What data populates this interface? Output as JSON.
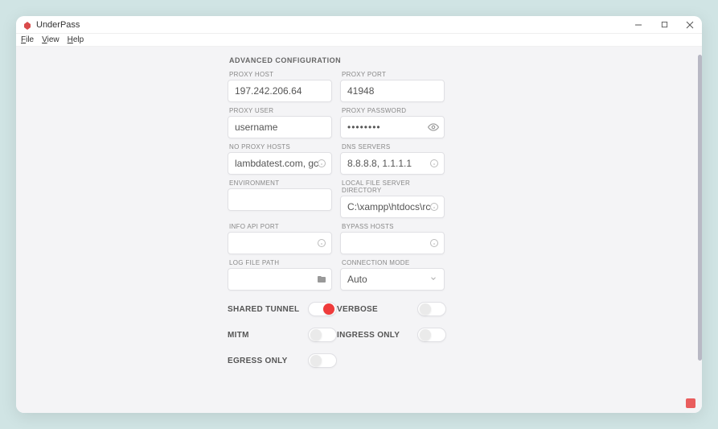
{
  "window": {
    "title": "UnderPass",
    "menu": {
      "file": "File",
      "view": "View",
      "help": "Help"
    }
  },
  "section": {
    "title": "ADVANCED CONFIGURATION"
  },
  "fields": {
    "proxy_host": {
      "label": "PROXY HOST",
      "value": "197.242.206.64"
    },
    "proxy_port": {
      "label": "PROXY PORT",
      "value": "41948"
    },
    "proxy_user": {
      "label": "PROXY USER",
      "value": "username"
    },
    "proxy_pass": {
      "label": "PROXY PASSWORD",
      "value": "••••••••"
    },
    "no_proxy": {
      "label": "NO PROXY HOSTS",
      "value": "lambdatest.com, gc"
    },
    "dns": {
      "label": "DNS SERVERS",
      "value": "8.8.8.8, 1.1.1.1"
    },
    "env": {
      "label": "ENVIRONMENT",
      "value": ""
    },
    "local_dir": {
      "label": "LOCAL FILE SERVER DIRECTORY",
      "value": "C:\\xampp\\htdocs\\rc"
    },
    "info_port": {
      "label": "INFO API PORT",
      "value": ""
    },
    "bypass": {
      "label": "BYPASS HOSTS",
      "value": ""
    },
    "log_path": {
      "label": "LOG FILE PATH",
      "value": ""
    },
    "conn_mode": {
      "label": "CONNECTION MODE",
      "value": "Auto"
    }
  },
  "toggles": {
    "shared": {
      "label": "SHARED TUNNEL",
      "on": true
    },
    "verbose": {
      "label": "VERBOSE",
      "on": false
    },
    "mitm": {
      "label": "MITM",
      "on": false
    },
    "ingress": {
      "label": "INGRESS ONLY",
      "on": false
    },
    "egress": {
      "label": "EGRESS ONLY",
      "on": false
    }
  }
}
